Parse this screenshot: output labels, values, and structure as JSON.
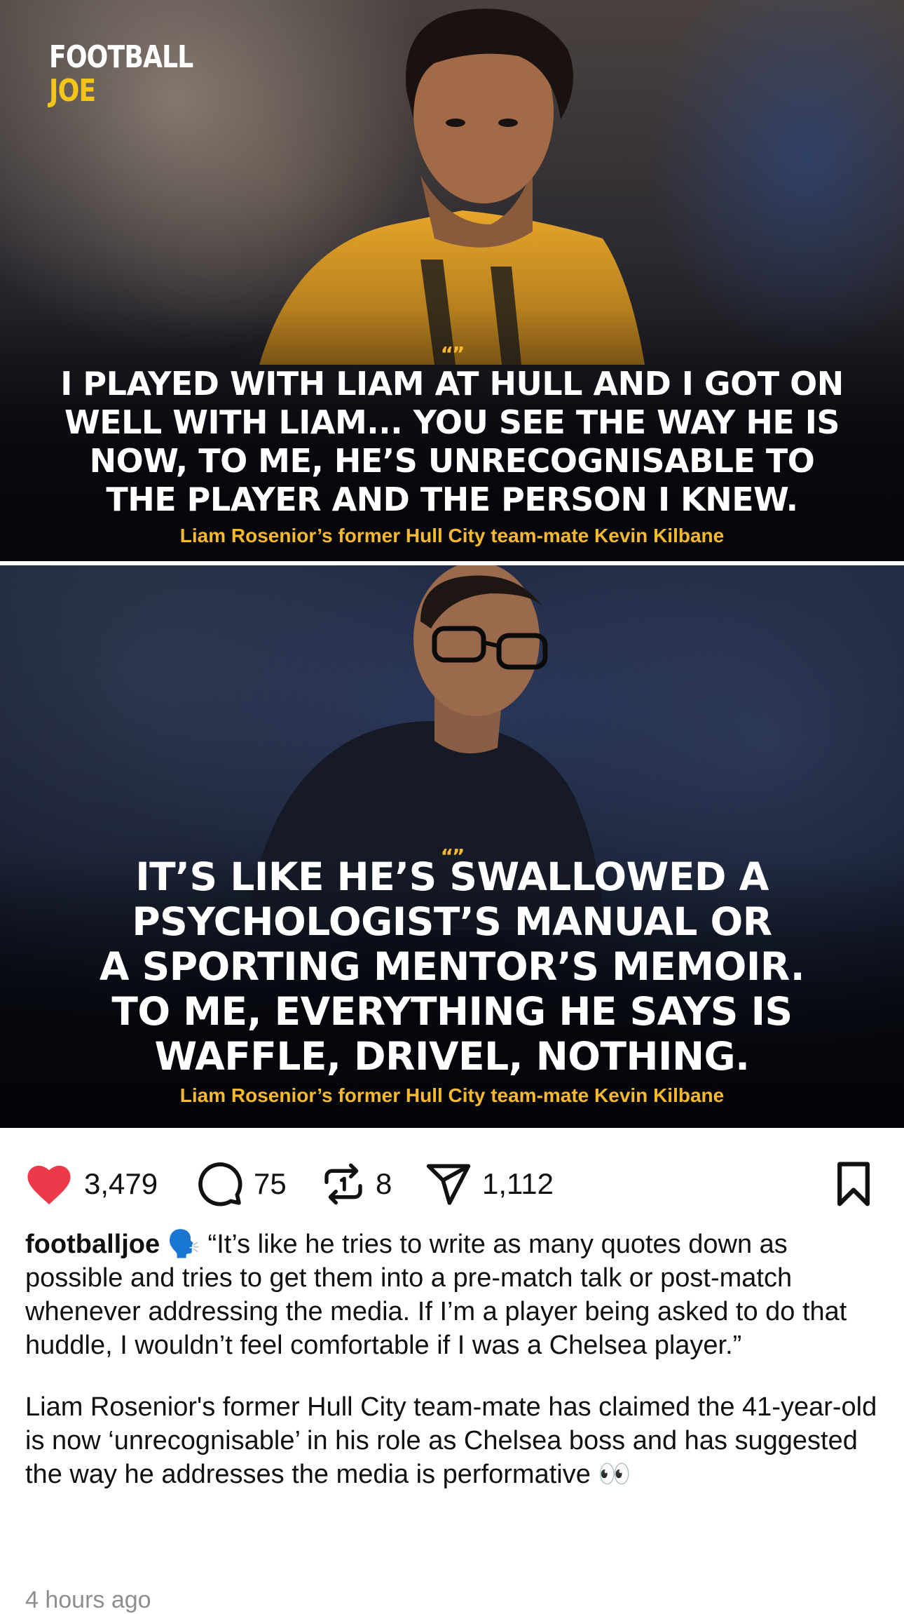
{
  "post": {
    "images": [
      {
        "brand_line1": "FOOTBALL",
        "brand_line2": "JOE",
        "quote_mark": "“”",
        "quote_lines": [
          "I PLAYED WITH LIAM AT HULL AND I GOT ON",
          "WELL WITH LIAM... YOU SEE THE WAY HE IS",
          "NOW, TO ME, HE’S UNRECOGNISABLE TO",
          "THE PLAYER AND THE PERSON I KNEW."
        ],
        "attribution": "Liam Rosenior’s former Hull City team-mate Kevin Kilbane"
      },
      {
        "quote_mark": "“”",
        "quote_lines": [
          "IT’S LIKE HE’S SWALLOWED A",
          "PSYCHOLOGIST’S MANUAL OR",
          "A SPORTING MENTOR’S MEMOIR.",
          "TO ME, EVERYTHING HE SAYS IS",
          "WAFFLE, DRIVEL, NOTHING."
        ],
        "attribution": "Liam Rosenior’s former Hull City team-mate Kevin Kilbane"
      }
    ],
    "actions": {
      "likes": "3,479",
      "comments": "75",
      "reposts": "8",
      "shares": "1,112"
    },
    "colors": {
      "like": "#ed3a4a",
      "accent_yellow": "#f5b82e",
      "brand_yellow": "#f5c518"
    },
    "caption": {
      "username": "footballjoe",
      "emoji": "🗣️",
      "text1": " “It’s like he tries to write as many quotes down as possible and tries to get them into a pre-match talk or post-match whenever addressing the media. If I’m a player being asked to do that huddle, I wouldn’t feel comfortable if I was a Chelsea player.”",
      "text2": "Liam Rosenior's former Hull City team-mate has claimed the 41-year-old is now ‘unrecognisable’ in his role as Chelsea boss and has suggested the way he addresses the media is performative 👀"
    },
    "timestamp": "4 hours ago"
  }
}
